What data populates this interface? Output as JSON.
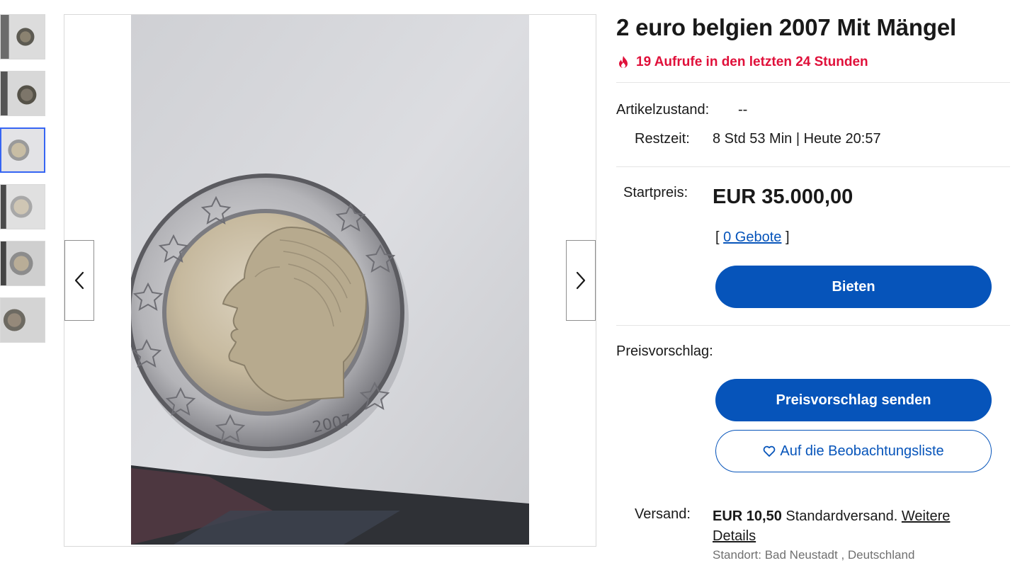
{
  "listing": {
    "title": "2 euro belgien 2007 Mit Mängel",
    "views_text": "19 Aufrufe in den letzten 24 Stunden",
    "condition_label": "Artikelzustand:",
    "condition_value": "--",
    "time_label": "Restzeit:",
    "time_value": "8 Std 53 Min | Heute 20:57",
    "start_price_label": "Startpreis:",
    "start_price_value": "EUR 35.000,00",
    "bids_open": "[",
    "bids_link": "0 Gebote",
    "bids_close": "]",
    "bid_button": "Bieten",
    "offer_label": "Preisvorschlag:",
    "offer_button": "Preisvorschlag senden",
    "watch_button": "Auf die Beobachtungsliste",
    "shipping_label": "Versand:",
    "shipping_price": "EUR 10,50",
    "shipping_type": "Standardversand.",
    "shipping_details_link": "Weitere Details",
    "location": "Standort: Bad Neustadt , Deutschland"
  },
  "gallery": {
    "thumbnail_count": 6,
    "selected_thumbnail": 3,
    "icons": [
      "chevron-left-icon",
      "chevron-right-icon",
      "fire-icon",
      "heart-icon"
    ]
  },
  "colors": {
    "accent": "#0654ba",
    "views": "#e0103a",
    "selected_border": "#3665f3"
  }
}
